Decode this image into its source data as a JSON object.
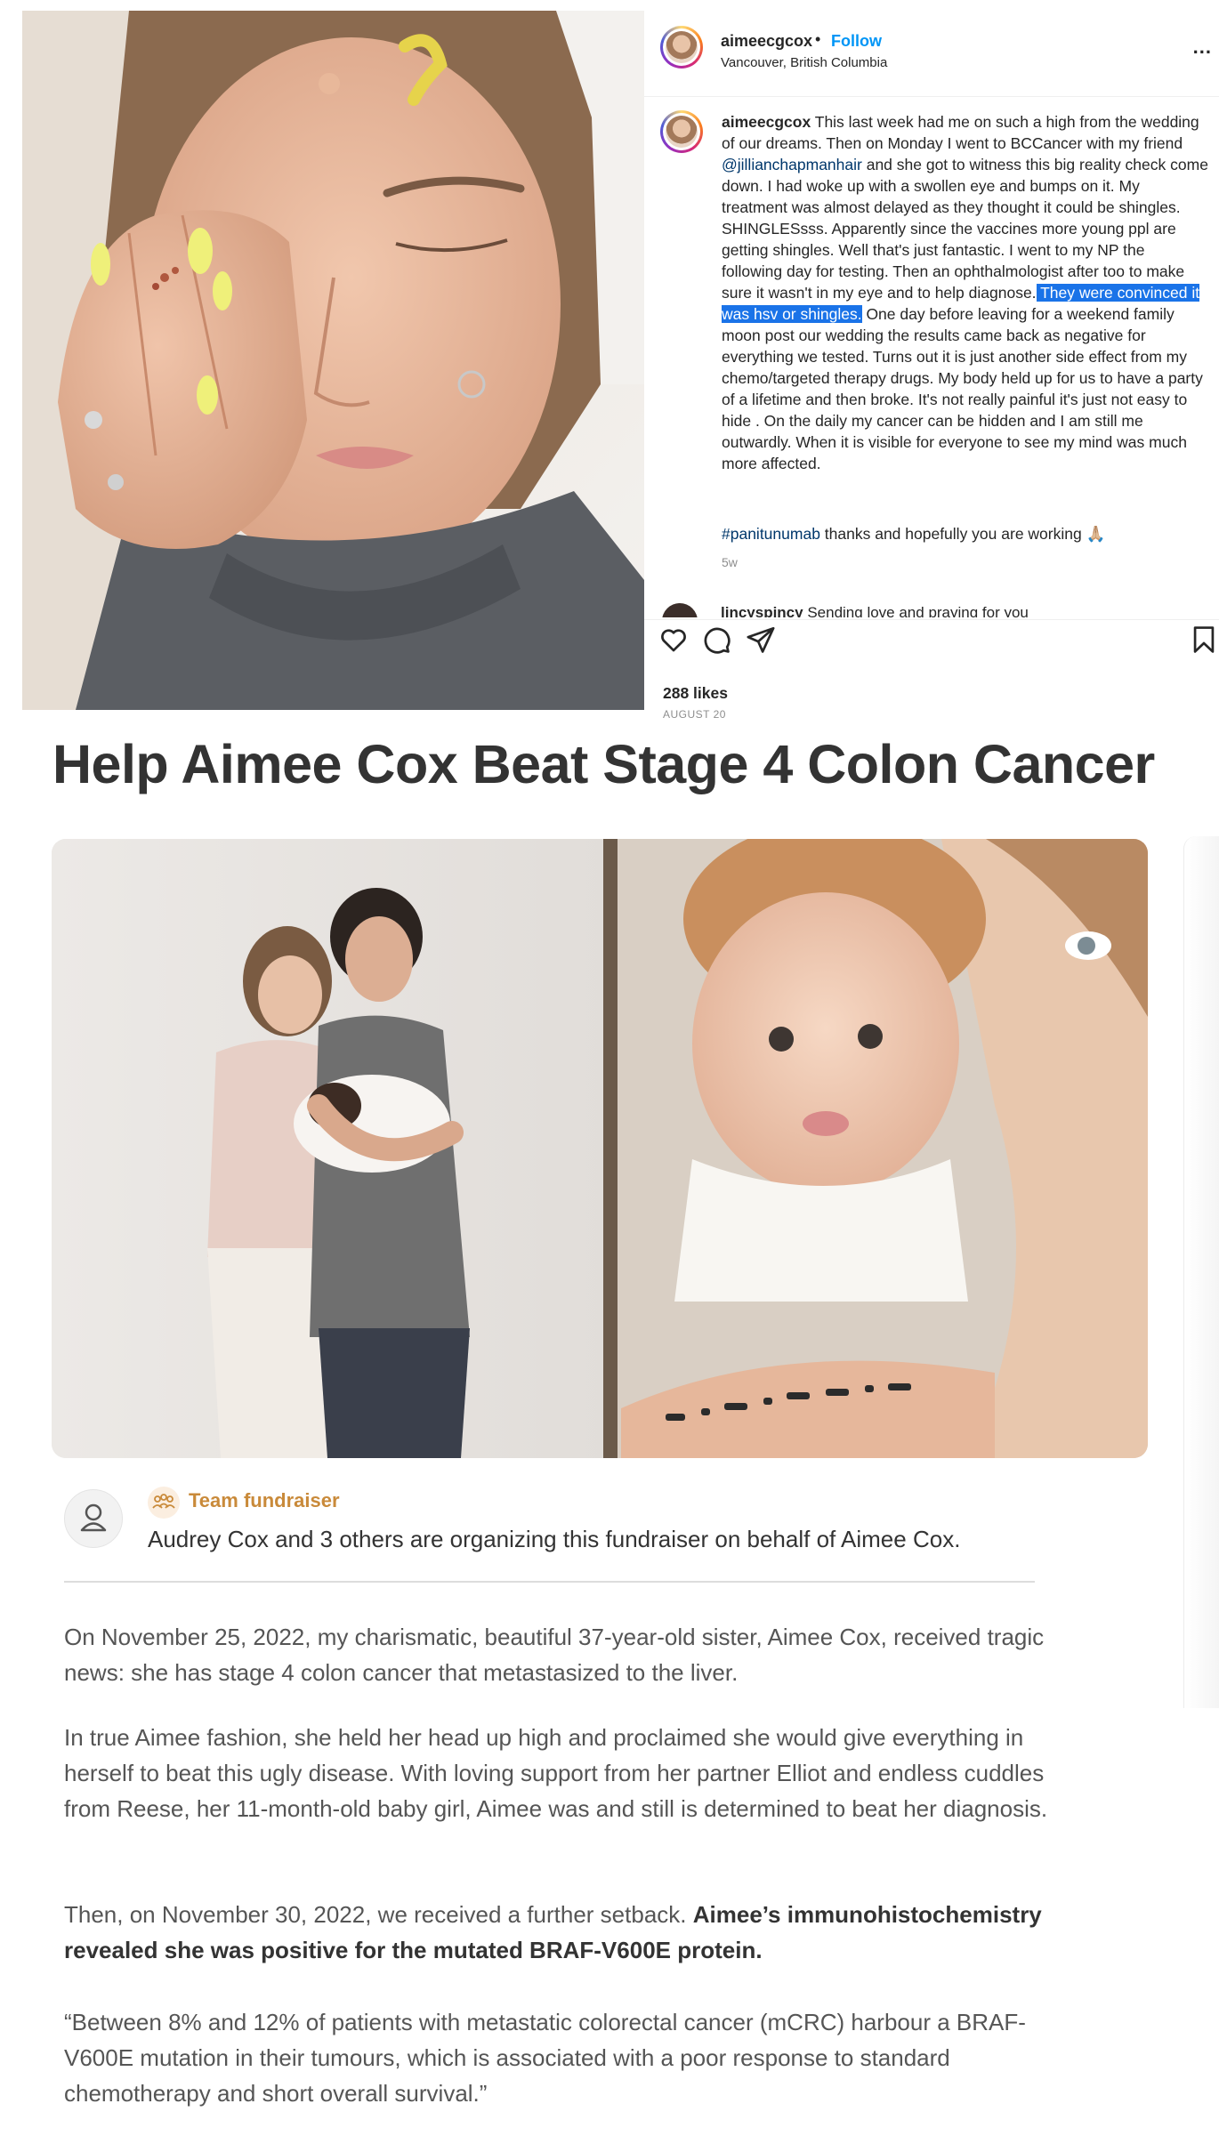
{
  "instagram": {
    "username": "aimeecgcox",
    "separator": "•",
    "follow_label": "Follow",
    "location": "Vancouver, British Columbia",
    "more_label": "...",
    "caption": {
      "username": "aimeecgcox",
      "text_1": " This last week had me on such a high from the wedding of our dreams. Then on Monday I went to BCCancer with my friend ",
      "mention": "@jillianchapmanhair",
      "text_2": " and she got to witness this big reality check come down. I had woke up with a swollen eye and bumps on it. My treatment was almost delayed as they thought it could be shingles. SHINGLESsss. Apparently since the vaccines more young ppl are getting shingles. Well that's just fantastic. I went to my NP the following day for testing. Then an ophthalmologist after too to make sure it wasn't in my eye and to help diagnose.",
      "highlighted": " They were convinced it was hsv or shingles.",
      "text_3": " One day before leaving for a weekend family moon post our wedding the results came back as negative for everything we tested. Turns out it is just another side effect from my chemo/targeted therapy drugs. My body held up for us to have a party of a lifetime and then broke. It's not really painful it's just not easy to hide . On the daily my cancer can be hidden and I am still me outwardly. When it is visible for everyone to see my mind was much more affected.",
      "hashtag": "#panitunumab",
      "hashtag_suffix": " thanks and hopefully you are working 🙏🏼",
      "age": "5w"
    },
    "comment_preview": {
      "username": "lincyspincy",
      "text": " Sending love and praying for you"
    },
    "likes": "288 likes",
    "date": "AUGUST 20",
    "icons": [
      "heart-icon",
      "comment-icon",
      "share-icon",
      "bookmark-icon"
    ]
  },
  "fundraiser": {
    "title": "Help Aimee Cox Beat Stage 4 Colon Cancer",
    "team_label": "Team fundraiser",
    "organizer_text": "Audrey Cox and 3 others are organizing this fundraiser on behalf of Aimee Cox.",
    "paragraphs": {
      "p1": "On November 25, 2022, my charismatic, beautiful 37-year-old sister, Aimee Cox, received tragic news: she has stage 4 colon cancer that metastasized to the liver.",
      "p2": "In true Aimee fashion, she held her head up high and proclaimed she would give everything in herself to beat this ugly disease. With loving support from her partner Elliot and endless cuddles from Reese, her 11-month-old baby girl, Aimee was and still is determined to beat her diagnosis.",
      "p3_plain": "Then, on November 30, 2022, we received a further setback. ",
      "p3_bold": "Aimee’s immunohistochemistry revealed she was positive for the mutated BRAF-V600E protein.",
      "p4": "“Between 8% and 12% of patients with metastatic colorectal cancer (mCRC) harbour a BRAF-V600E mutation in their tumours, which is associated with a poor response to standard chemotherapy and short overall survival.”"
    },
    "accent_color": "#c98a3a"
  },
  "colors": {
    "instagram_blue": "#0095f6",
    "mention_blue": "#00376b",
    "selection_highlight": "#1a73e8"
  }
}
